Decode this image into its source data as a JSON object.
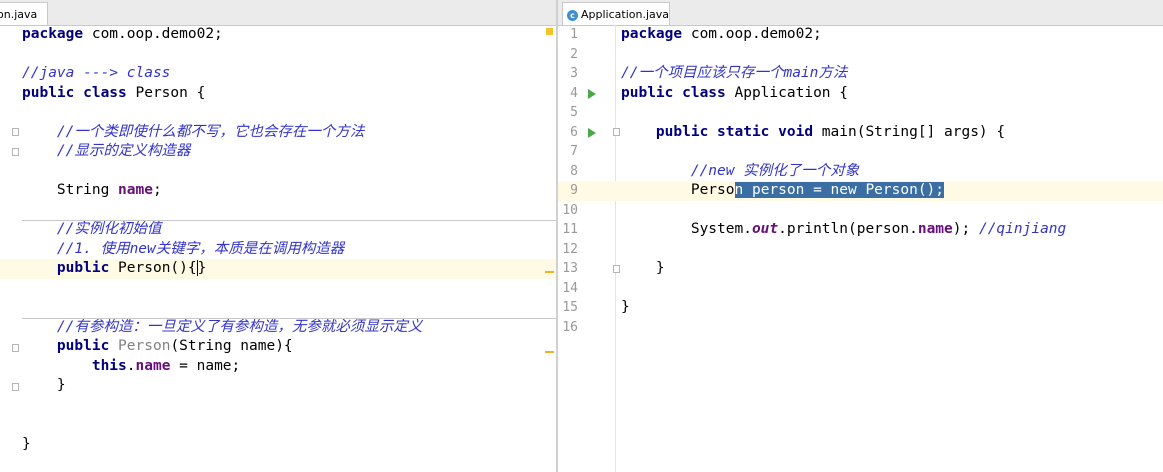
{
  "left_editor": {
    "tab_label": "on.java",
    "lines": [
      {
        "parts": [
          [
            "kw",
            "package"
          ],
          [
            "",
            " com.oop.demo02;"
          ]
        ]
      },
      {
        "parts": []
      },
      {
        "parts": [
          [
            "cm",
            "//java ---> class"
          ]
        ]
      },
      {
        "parts": [
          [
            "kw",
            "public class"
          ],
          [
            "",
            " Person {"
          ]
        ]
      },
      {
        "parts": []
      },
      {
        "parts": [
          [
            "",
            "    "
          ],
          [
            "cm",
            "//一个类即使什么都不写，它也会存在一个方法"
          ]
        ]
      },
      {
        "parts": [
          [
            "",
            "    "
          ],
          [
            "cm",
            "//显示的定义构造器"
          ]
        ]
      },
      {
        "parts": []
      },
      {
        "parts": [
          [
            "",
            "    String "
          ],
          [
            "fld",
            "name"
          ],
          [
            "",
            ";"
          ]
        ]
      },
      {
        "parts": []
      },
      {
        "parts": [
          [
            "",
            "    "
          ],
          [
            "cm",
            "//实例化初始值"
          ]
        ]
      },
      {
        "parts": [
          [
            "",
            "    "
          ],
          [
            "cm",
            "//1. 使用new关键字，本质是在调用构造器"
          ]
        ]
      },
      {
        "parts": [
          [
            "",
            "    "
          ],
          [
            "kw",
            "public"
          ],
          [
            "",
            " Person(){"
          ],
          [
            "caret",
            ""
          ],
          [
            "",
            "}"
          ]
        ],
        "current": true
      },
      {
        "parts": []
      },
      {
        "parts": []
      },
      {
        "parts": [
          [
            "",
            "    "
          ],
          [
            "cm",
            "//有参构造：一旦定义了有参构造，无参就必须显示定义"
          ]
        ]
      },
      {
        "parts": [
          [
            "",
            "    "
          ],
          [
            "kw",
            "public"
          ],
          [
            "",
            " "
          ],
          [
            "gry",
            "Person"
          ],
          [
            "",
            "(String name){"
          ]
        ]
      },
      {
        "parts": [
          [
            "",
            "        "
          ],
          [
            "kw",
            "this"
          ],
          [
            "",
            "."
          ],
          [
            "fld",
            "name"
          ],
          [
            "",
            " = name;"
          ]
        ]
      },
      {
        "parts": [
          [
            "",
            "    }"
          ]
        ]
      },
      {
        "parts": []
      },
      {
        "parts": []
      },
      {
        "parts": [
          [
            "",
            "}"
          ]
        ]
      }
    ]
  },
  "right_editor": {
    "tab_label": "Application.java",
    "tab_icon": "c",
    "lines": [
      {
        "num": "1",
        "parts": [
          [
            "kw",
            "package"
          ],
          [
            "",
            " com.oop.demo02;"
          ]
        ]
      },
      {
        "num": "2",
        "parts": []
      },
      {
        "num": "3",
        "parts": [
          [
            "cm",
            "//一个项目应该只存一个main方法"
          ]
        ]
      },
      {
        "num": "4",
        "parts": [
          [
            "kw",
            "public class"
          ],
          [
            "",
            " Application {"
          ]
        ]
      },
      {
        "num": "5",
        "parts": []
      },
      {
        "num": "6",
        "parts": [
          [
            "",
            "    "
          ],
          [
            "kw",
            "public static void"
          ],
          [
            "",
            " main(String[] args) {"
          ]
        ]
      },
      {
        "num": "7",
        "parts": []
      },
      {
        "num": "8",
        "parts": [
          [
            "",
            "        "
          ],
          [
            "cm",
            "//new 实例化了一个对象"
          ]
        ]
      },
      {
        "num": "9",
        "parts": [
          [
            "",
            "        Perso"
          ],
          [
            "sel",
            "n person = new Person();"
          ]
        ],
        "current": true
      },
      {
        "num": "10",
        "parts": []
      },
      {
        "num": "11",
        "parts": [
          [
            "",
            "        System."
          ],
          [
            "fldi",
            "out"
          ],
          [
            "",
            ".println(person."
          ],
          [
            "fld",
            "name"
          ],
          [
            "",
            "); "
          ],
          [
            "cm",
            "//qinjiang"
          ]
        ]
      },
      {
        "num": "12",
        "parts": []
      },
      {
        "num": "13",
        "parts": [
          [
            "",
            "    }"
          ]
        ]
      },
      {
        "num": "14",
        "parts": []
      },
      {
        "num": "15",
        "parts": [
          [
            "",
            "}"
          ]
        ]
      },
      {
        "num": "16",
        "parts": []
      }
    ]
  },
  "colors": {
    "keyword": "#000080",
    "comment": "#3333cc",
    "field": "#660e7a",
    "selection": "#3a6ea5",
    "current_line": "#fffae3",
    "run_marker": "#4ca64c"
  }
}
